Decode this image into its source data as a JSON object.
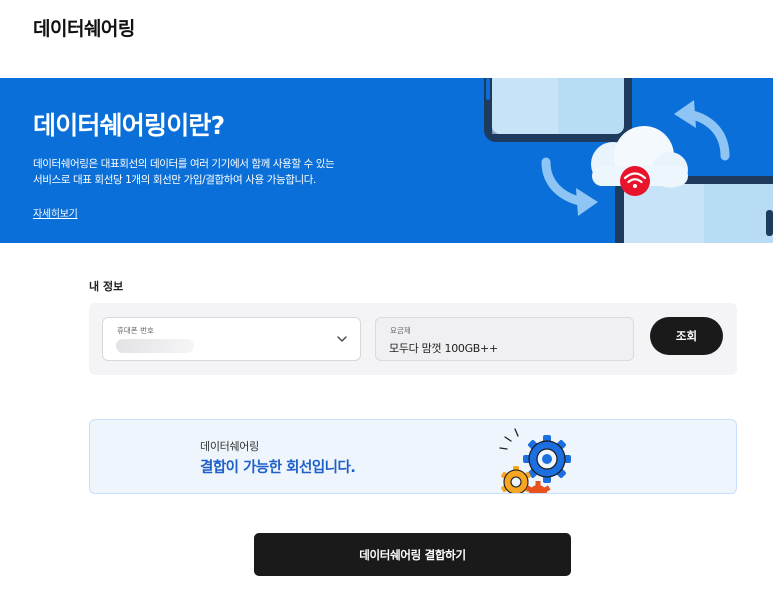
{
  "page": {
    "title": "데이터쉐어링"
  },
  "banner": {
    "title": "데이터쉐어링이란?",
    "description_line1": "데이터쉐어링은 대표회선의 데이터를 여러 기기에서 함께 사용할 수 있는",
    "description_line2": "서비스로 대표 회선당 1개의 회선만 가입/결합하여 사용 가능합니다.",
    "more_link": "자세히보기",
    "bg_color": "#0a6fd8"
  },
  "my_info": {
    "label": "내 정보",
    "phone_label": "휴대폰 번호",
    "plan_label": "요금제",
    "plan_value": "모두다 맘껏 100GB++",
    "lookup_button": "조회"
  },
  "result": {
    "subtitle": "데이터쉐어링",
    "message": "결합이 가능한 회선입니다.",
    "accent_color": "#1f5fc8"
  },
  "actions": {
    "primary_button": "데이터쉐어링 결합하기"
  }
}
